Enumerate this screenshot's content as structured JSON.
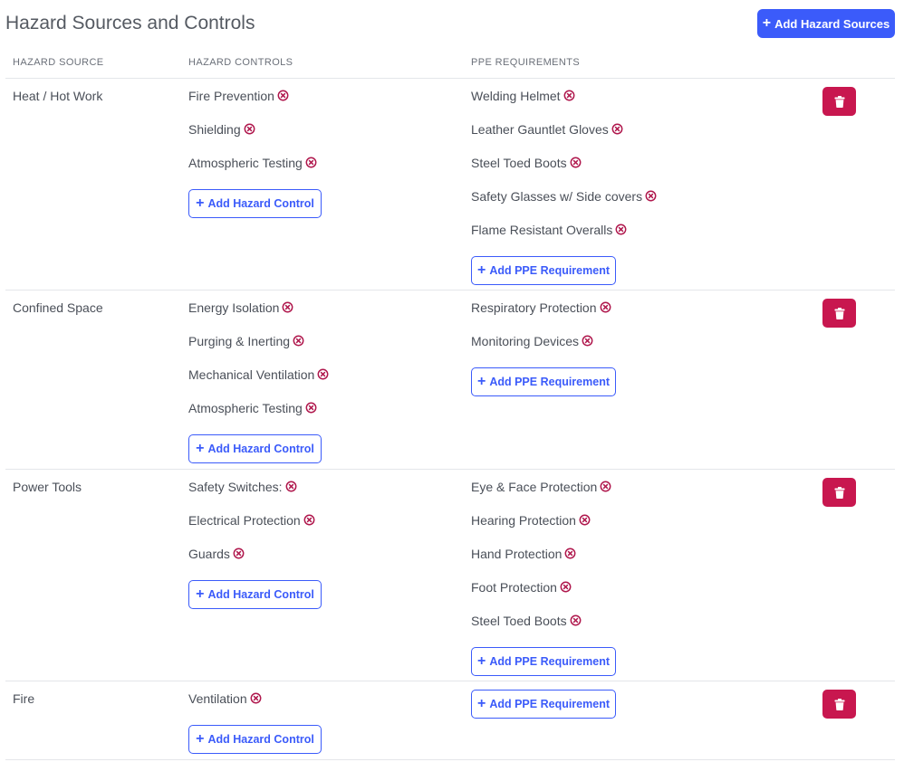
{
  "page": {
    "title": "Hazard Sources and Controls",
    "add_sources_label": "Add Hazard Sources"
  },
  "columns": {
    "source": "HAZARD SOURCE",
    "controls": "HAZARD CONTROLS",
    "ppe": "PPE REQUIREMENTS"
  },
  "buttons": {
    "add_control": "Add Hazard Control",
    "add_ppe": "Add PPE Requirement"
  },
  "colors": {
    "primary": "#3b5bfa",
    "danger": "#c8174f",
    "remove_icon": "#b0184d",
    "divider": "#e4e6ea"
  },
  "icons": {
    "add": "plus-icon",
    "remove": "remove-circle-x-icon",
    "delete": "trash-icon"
  },
  "hazards": [
    {
      "source": "Heat / Hot Work",
      "controls": [
        "Fire Prevention",
        "Shielding",
        "Atmospheric Testing"
      ],
      "ppe": [
        "Welding Helmet",
        "Leather Gauntlet Gloves",
        "Steel Toed Boots",
        "Safety Glasses w/ Side covers",
        "Flame Resistant Overalls"
      ]
    },
    {
      "source": "Confined Space",
      "controls": [
        "Energy Isolation",
        "Purging & Inerting",
        "Mechanical Ventilation",
        "Atmospheric Testing"
      ],
      "ppe": [
        "Respiratory Protection",
        "Monitoring Devices"
      ]
    },
    {
      "source": "Power Tools",
      "controls": [
        "Safety Switches:",
        "Electrical Protection",
        "Guards"
      ],
      "ppe": [
        "Eye & Face Protection",
        "Hearing Protection",
        "Hand Protection",
        "Foot Protection",
        "Steel Toed Boots"
      ]
    },
    {
      "source": "Fire",
      "controls": [
        "Ventilation"
      ],
      "ppe": []
    }
  ]
}
